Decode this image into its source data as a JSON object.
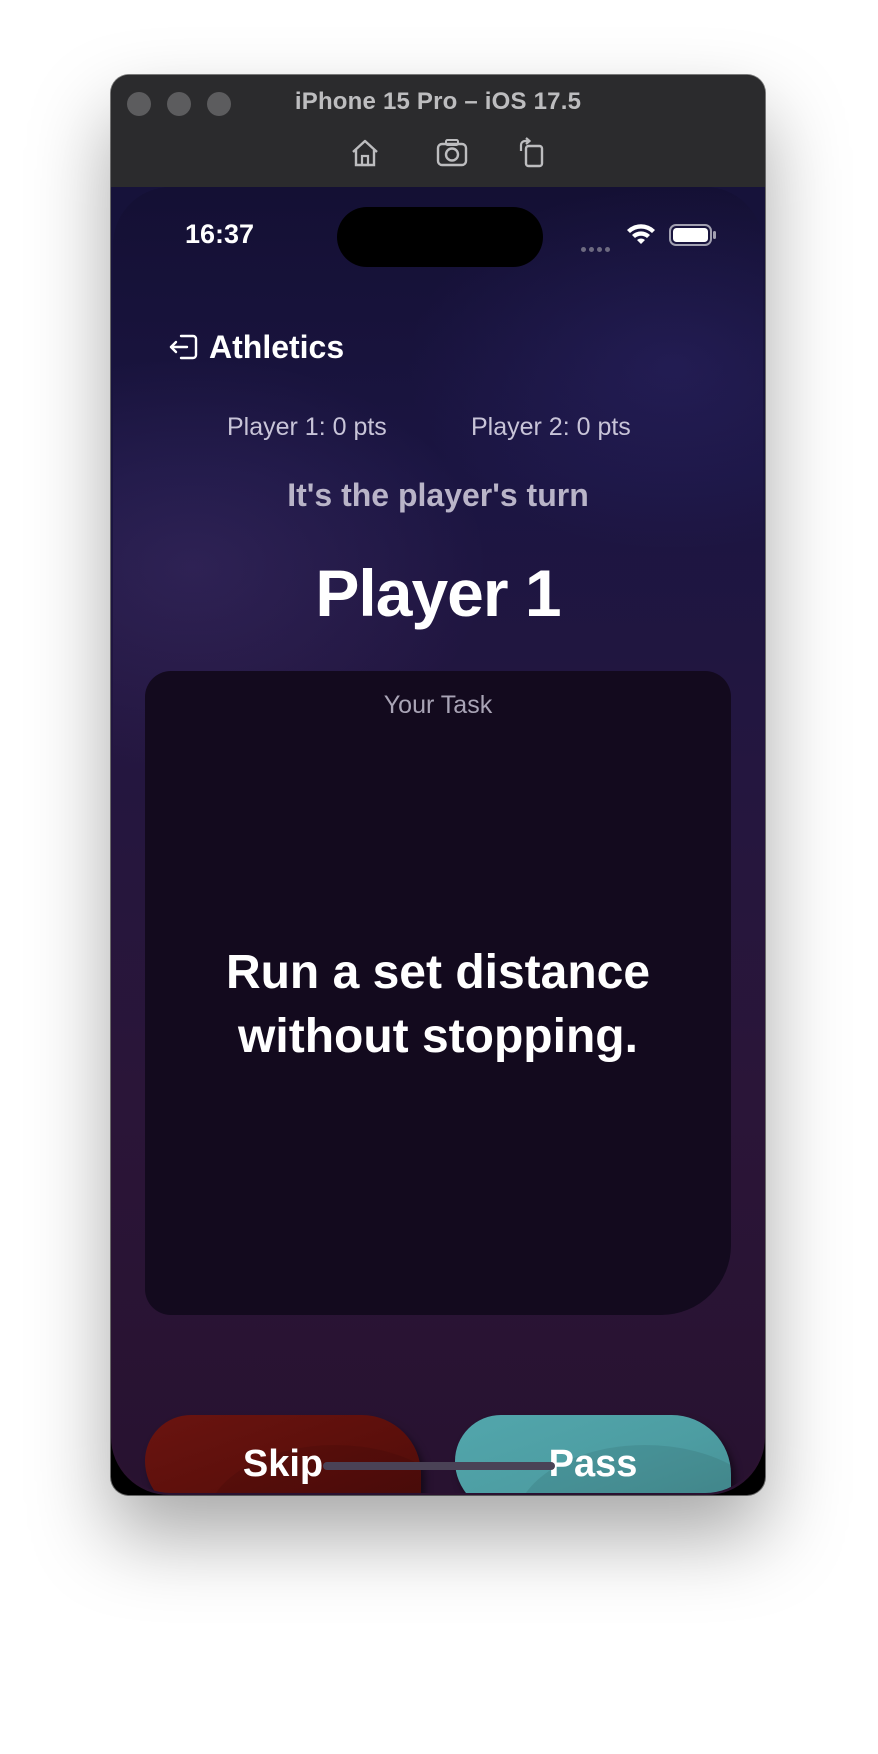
{
  "simulator": {
    "title": "iPhone 15 Pro – iOS 17.5",
    "toolbar_icons": [
      "home-icon",
      "screenshot-icon",
      "rotate-icon"
    ]
  },
  "status_bar": {
    "time": "16:37",
    "icons": [
      "signal-icon",
      "wifi-icon",
      "battery-icon"
    ]
  },
  "header": {
    "back_label": "Athletics",
    "back_icon": "exit-icon"
  },
  "scores": [
    {
      "label": "Player 1: 0 pts"
    },
    {
      "label": "Player 2: 0 pts"
    }
  ],
  "turn": {
    "prompt": "It's the player's turn",
    "player": "Player 1"
  },
  "task": {
    "label": "Your Task",
    "text": "Run a set distance without stopping."
  },
  "actions": {
    "skip": "Skip",
    "pass": "Pass"
  },
  "colors": {
    "skip_button": "#5c0f0b",
    "pass_button": "#4d9da2",
    "card": "#130a1e"
  }
}
